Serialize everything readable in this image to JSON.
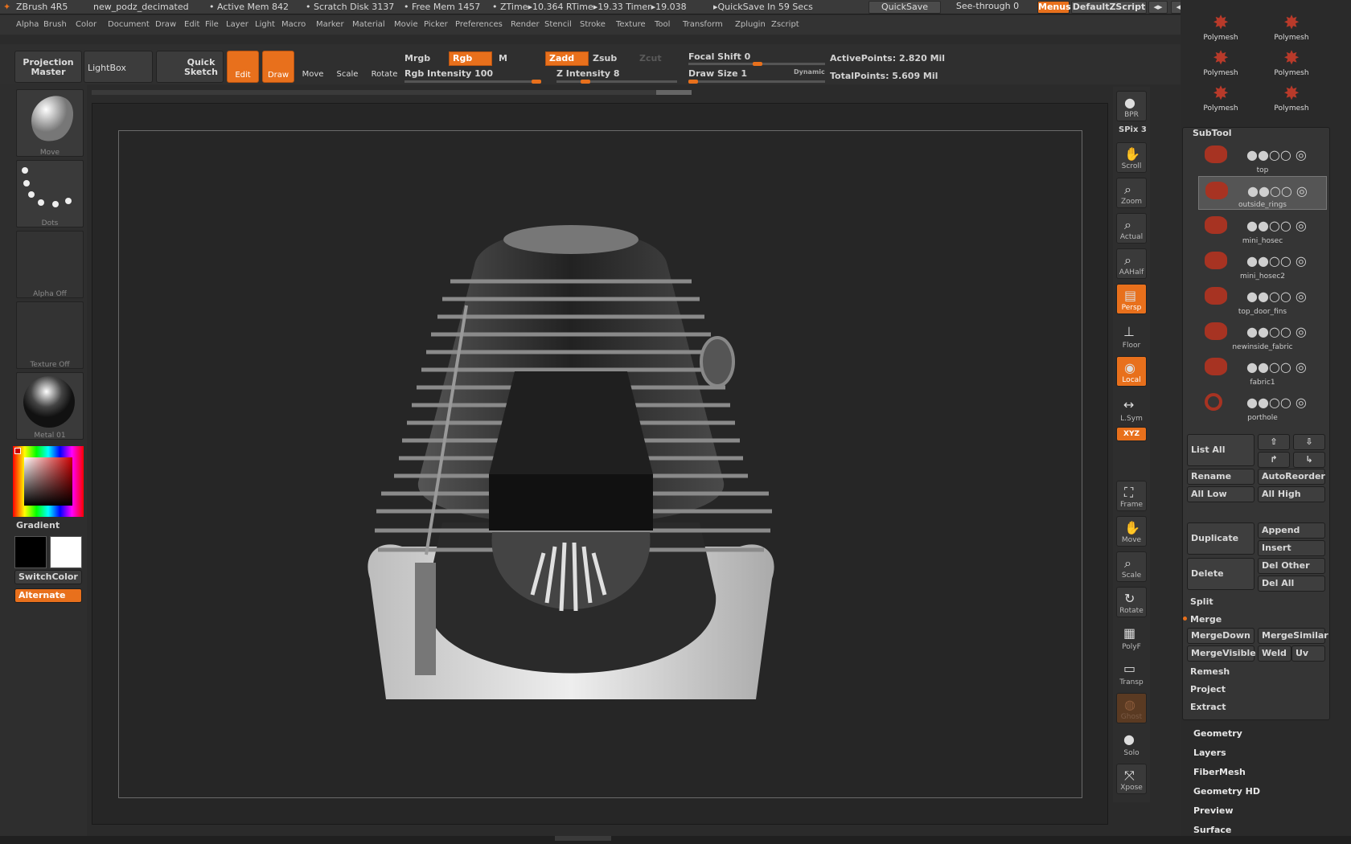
{
  "title_bar": {
    "app": "ZBrush 4R5",
    "document": "new_podz_decimated",
    "active_mem": "• Active Mem 842",
    "scratch_disk": "• Scratch Disk 3137",
    "free_mem": "• Free Mem 1457",
    "ztime": "• ZTime▸10.364 RTime▸19.33 Timer▸19.038",
    "quicksave_info": "▸QuickSave In 59 Secs",
    "quicksave_btn": "QuickSave",
    "see_through": "See-through  0",
    "menus_btn": "Menus",
    "script_btn": "DefaultZScript"
  },
  "menu": [
    "Alpha",
    "Brush",
    "Color",
    "Document",
    "Draw",
    "Edit",
    "File",
    "Layer",
    "Light",
    "Macro",
    "Marker",
    "Material",
    "Movie",
    "Picker",
    "Preferences",
    "Render",
    "Stencil",
    "Stroke",
    "Texture",
    "Tool",
    "Transform",
    "Zplugin",
    "Zscript"
  ],
  "shelf": {
    "projection_master": "Projection Master",
    "lightbox": "LightBox",
    "quick_sketch": "Quick Sketch",
    "edit": "Edit",
    "draw": "Draw",
    "move": "Move",
    "scale": "Scale",
    "rotate": "Rotate",
    "mrgb": "Mrgb",
    "rgb": "Rgb",
    "m": "M",
    "zadd": "Zadd",
    "zsub": "Zsub",
    "zcut": "Zcut",
    "rgb_intensity": "Rgb Intensity 100",
    "z_intensity": "Z Intensity 8",
    "focal_shift": "Focal Shift 0",
    "draw_size": "Draw Size 1",
    "dynamic": "Dynamic",
    "active_points": "ActivePoints: 2.820 Mil",
    "total_points": "TotalPoints: 5.609 Mil"
  },
  "left": {
    "move": "Move",
    "dots": "Dots",
    "alpha": "Alpha Off",
    "texture": "Texture Off",
    "material": "Metal 01",
    "gradient": "Gradient",
    "switch_color": "SwitchColor",
    "alternate": "Alternate"
  },
  "right_strip": {
    "bpr": "BPR",
    "spix": "SPix 3",
    "buttons": [
      "Scroll",
      "Zoom",
      "Actual",
      "AAHalf",
      "Persp",
      "Floor",
      "Local",
      "L.Sym",
      "XYZ",
      "Frame",
      "Move",
      "Scale",
      "Rotate",
      "PolyF",
      "Transp",
      "Ghost",
      "Solo",
      "Xpose"
    ]
  },
  "tool_palette": {
    "polymesh": "Polymesh",
    "subtool_title": "SubTool",
    "subtools": [
      "top",
      "outside_rings",
      "mini_hosec",
      "mini_hosec2",
      "top_door_fins",
      "newinside_fabric",
      "fabric1",
      "porthole"
    ],
    "selected_index": 1,
    "list_all": "List All",
    "rename": "Rename",
    "auto_reorder": "AutoReorder",
    "all_low": "All Low",
    "all_high": "All High",
    "duplicate": "Duplicate",
    "append": "Append",
    "insert": "Insert",
    "delete": "Delete",
    "del_other": "Del Other",
    "del_all": "Del All",
    "split": "Split",
    "merge": "Merge",
    "merge_down": "MergeDown",
    "merge_similar": "MergeSimilar",
    "merge_visible": "MergeVisible",
    "weld": "Weld",
    "uv": "Uv",
    "remesh": "Remesh",
    "project": "Project",
    "extract": "Extract"
  },
  "tray_sections": [
    "Geometry",
    "Layers",
    "FiberMesh",
    "Geometry HD",
    "Preview",
    "Surface"
  ]
}
